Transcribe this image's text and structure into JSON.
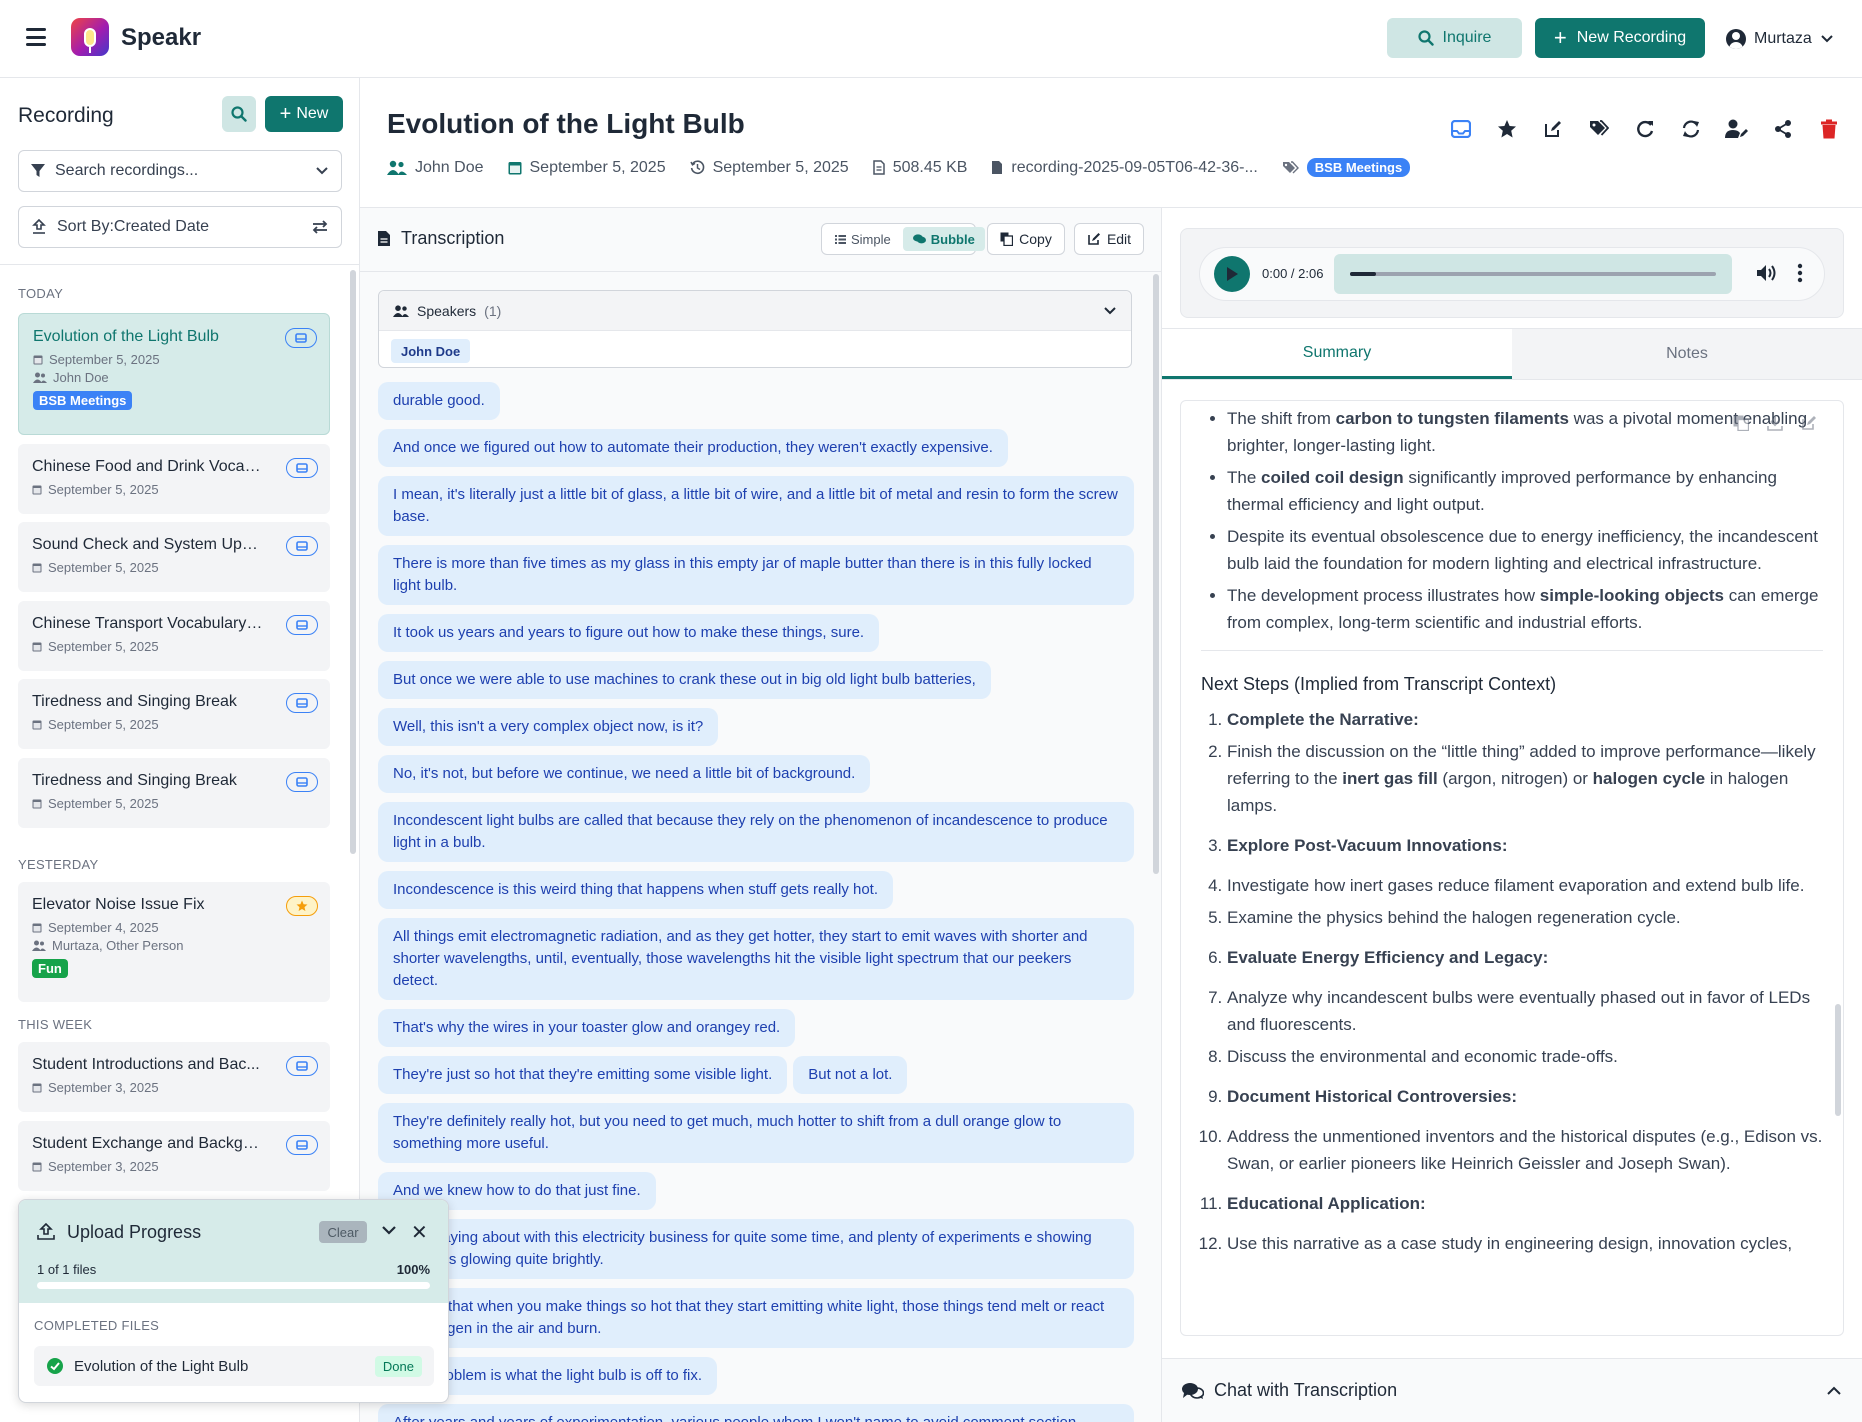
{
  "app": {
    "name": "Speakr",
    "inquire_label": "Inquire",
    "new_recording_label": "New Recording",
    "user_name": "Murtaza"
  },
  "sidebar": {
    "title": "Recording",
    "new_label": "New",
    "search_placeholder": "Search recordings...",
    "sort_label": "Sort By:Created Date",
    "groups": {
      "today": "TODAY",
      "yesterday": "YESTERDAY",
      "this_week": "THIS WEEK"
    },
    "items": [
      {
        "title": "Evolution of the Light Bulb",
        "date": "September 5, 2025",
        "speakers": "John Doe",
        "tag": "BSB Meetings"
      },
      {
        "title": "Chinese Food and Drink Vocab...",
        "date": "September 5, 2025"
      },
      {
        "title": "Sound Check and System Upd...",
        "date": "September 5, 2025"
      },
      {
        "title": "Chinese Transport Vocabulary ...",
        "date": "September 5, 2025"
      },
      {
        "title": "Tiredness and Singing Break",
        "date": "September 5, 2025"
      },
      {
        "title": "Tiredness and Singing Break",
        "date": "September 5, 2025"
      },
      {
        "title": "Elevator Noise Issue Fix",
        "date": "September 4, 2025",
        "speakers": "Murtaza, Other Person",
        "tag": "Fun"
      },
      {
        "title": "Student Introductions and Bac...",
        "date": "September 3, 2025"
      },
      {
        "title": "Student Exchange and Backgro...",
        "date": "September 3, 2025"
      }
    ]
  },
  "upload": {
    "title": "Upload Progress",
    "clear_label": "Clear",
    "count_text": "1 of 1 files",
    "percent_text": "100%",
    "progress": 1.0,
    "completed_label": "COMPLETED FILES",
    "file_name": "Evolution of the Light Bulb",
    "file_status": "Done"
  },
  "recording": {
    "title": "Evolution of the Light Bulb",
    "speaker": "John Doe",
    "created_date": "September 5, 2025",
    "meeting_date": "September 5, 2025",
    "file_size": "508.45 KB",
    "file_name": "recording-2025-09-05T06-42-36-...",
    "tag": "BSB Meetings"
  },
  "transcription": {
    "title": "Transcription",
    "view_simple": "Simple",
    "view_bubble": "Bubble",
    "copy_label": "Copy",
    "edit_label": "Edit",
    "speakers_label": "Speakers",
    "speakers_count": "(1)",
    "speaker_chip": "John Doe",
    "lines": [
      [
        "durable good."
      ],
      [
        "And once we figured out how to automate their production, they weren't exactly expensive."
      ],
      [
        "I mean, it's literally just a little bit of glass, a little bit of wire, and a little bit of metal and resin to form the screw base."
      ],
      [
        "There is more than five times as my glass in this empty jar of maple butter than there is in this fully locked light bulb."
      ],
      [
        "It took us years and years to figure out how to make these things, sure."
      ],
      [
        "But once we were able to use machines to crank these out in big old light bulb batteries,"
      ],
      [
        "Well, this isn't a very complex object now, is it?"
      ],
      [
        "No, it's not, but before we continue, we need a little bit of background."
      ],
      [
        "Incondescent light bulbs are called that because they rely on the phenomenon of incandescence to produce light in a bulb."
      ],
      [
        "Incondescence is this weird thing that happens when stuff gets really hot."
      ],
      [
        "All things emit electromagnetic radiation, and as they get hotter, they start to emit waves with shorter and shorter wavelengths, until, eventually, those wavelengths hit the visible light spectrum that our peekers detect."
      ],
      [
        "That's why the wires in your toaster glow and orangey red."
      ],
      [
        "They're just so hot that they're emitting some visible light.",
        "But not a lot."
      ],
      [
        "They're definitely really hot, but you need to get much, much hotter to shift from a dull orange glow to something more useful."
      ],
      [
        "And we knew how to do that just fine."
      ],
      [
        "been playing about with this electricity business for quite some time, and plenty of experiments e showing thin wires glowing quite brightly."
      ],
      [
        "ble was that when you make things so hot that they start emitting white light, those things tend melt or react with oxygen in the air and burn."
      ],
      [
        "t little problem is what the light bulb is off to fix."
      ],
      [
        "After years and years of experimentation, various people whom I won't name to avoid comment section"
      ]
    ]
  },
  "player": {
    "time": "0:00 / 2:06",
    "progress": 0.07
  },
  "tabs": {
    "summary": "Summary",
    "notes": "Notes"
  },
  "summary": {
    "bullets": [
      {
        "pre": "The shift from ",
        "bold": "carbon to tungsten filaments",
        "post": " was a pivotal moment enabling brighter, longer-lasting light."
      },
      {
        "pre": "The ",
        "bold": "coiled coil design",
        "post": " significantly improved performance by enhancing thermal efficiency and light output."
      },
      {
        "pre": "Despite its eventual obsolescence due to energy inefficiency, the incandescent bulb laid the foundation for modern lighting and electrical infrastructure.",
        "bold": "",
        "post": ""
      },
      {
        "pre": "The development process illustrates how ",
        "bold": "simple-looking objects",
        "post": " can emerge from complex, long-term scientific and industrial efforts."
      }
    ],
    "next_steps_heading": "Next Steps (Implied from Transcript Context)",
    "steps": {
      "s1": "Complete the Narrative:",
      "s2_a": "Finish the discussion on the “little thing” added to improve performance—likely referring to the ",
      "s2_b": "inert gas fill",
      "s2_c": " (argon, nitrogen) or ",
      "s2_d": "halogen cycle",
      "s2_e": " in halogen lamps.",
      "s3": "Explore Post-Vacuum Innovations:",
      "s4": "Investigate how inert gases reduce filament evaporation and extend bulb life.",
      "s5": "Examine the physics behind the halogen regeneration cycle.",
      "s6": "Evaluate Energy Efficiency and Legacy:",
      "s7": "Analyze why incandescent bulbs were eventually phased out in favor of LEDs and fluorescents.",
      "s8": "Discuss the environmental and economic trade-offs.",
      "s9": "Document Historical Controversies:",
      "s10": "Address the unmentioned inventors and the historical disputes (e.g., Edison vs. Swan, or earlier pioneers like Heinrich Geissler and Joseph Swan).",
      "s11": "Educational Application:",
      "s12": "Use this narrative as a case study in engineering design, innovation cycles,"
    }
  },
  "chat": {
    "title": "Chat with Transcription"
  },
  "colors": {
    "accent": "#0f766e",
    "accent_light": "#cfe6e4",
    "bubble_bg": "#e0eefc",
    "tag_blue": "#3b82f6",
    "tag_green": "#16a34a",
    "danger": "#dc2626"
  }
}
